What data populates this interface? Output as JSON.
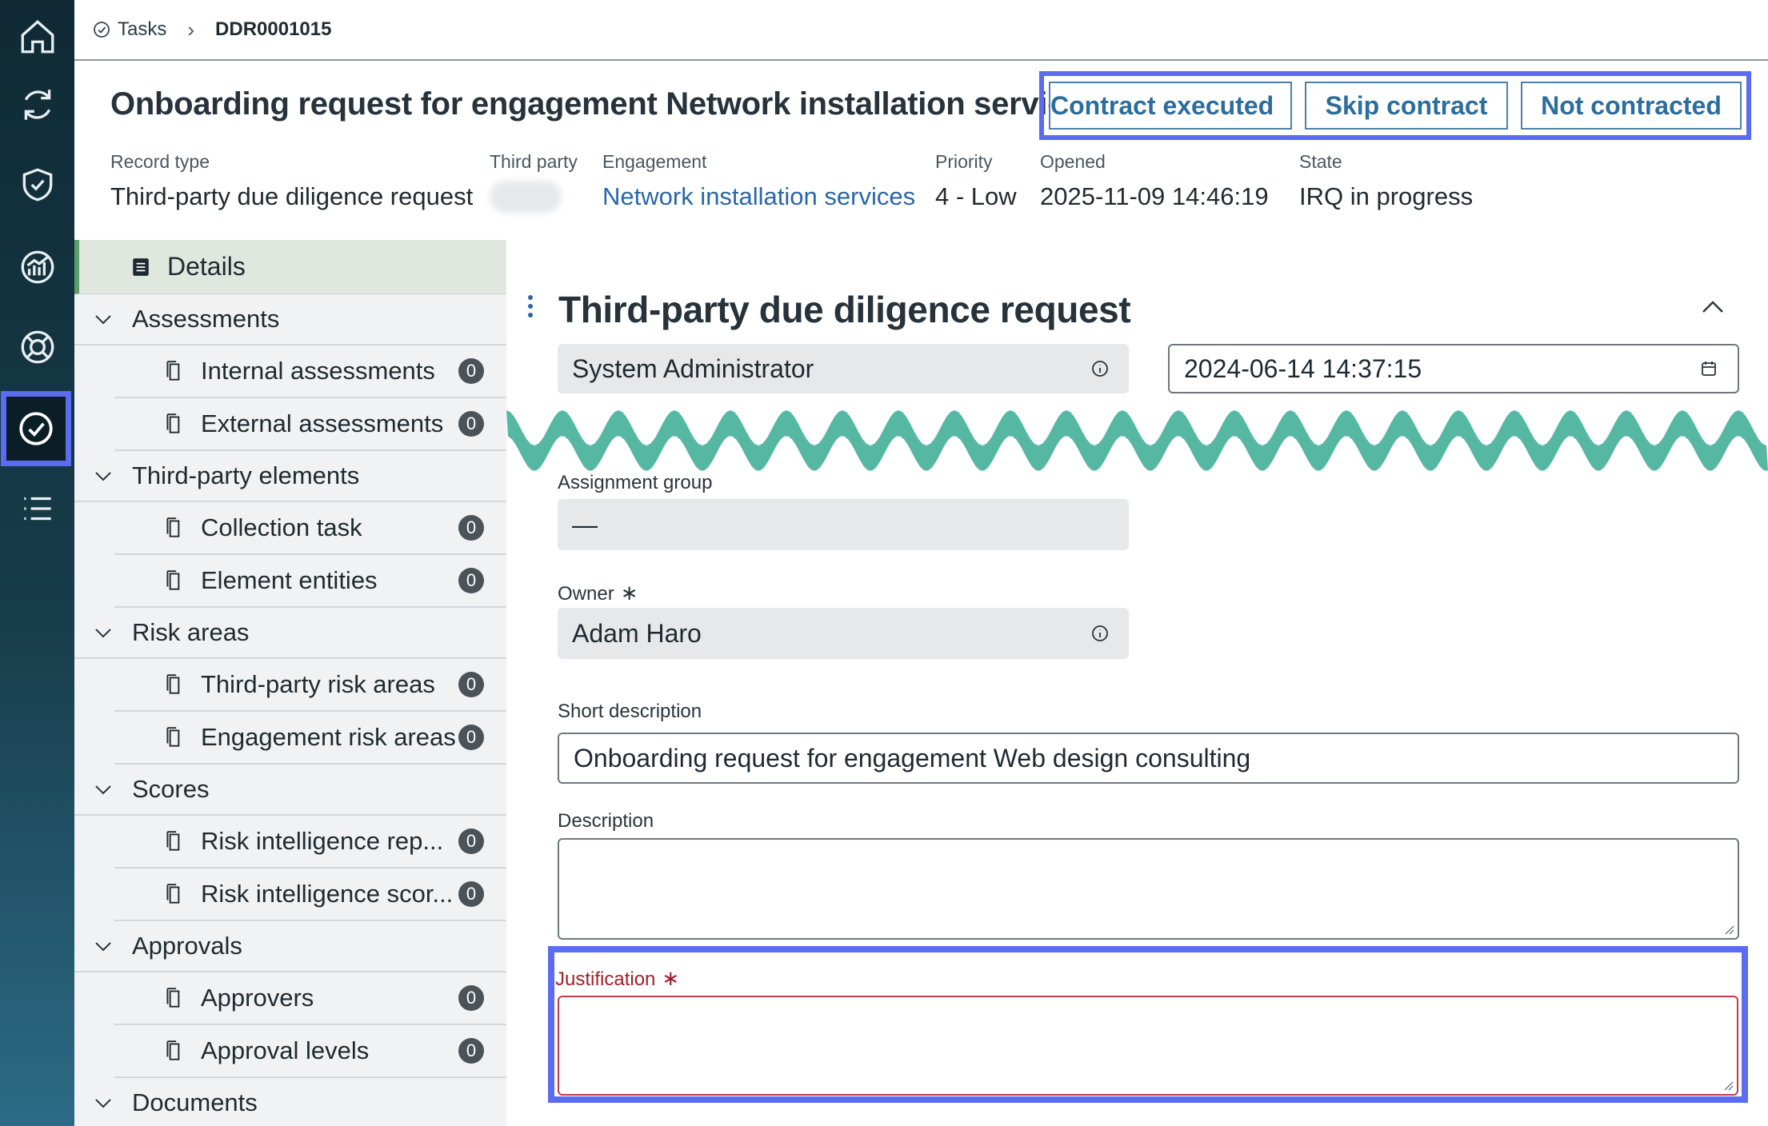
{
  "breadcrumb": {
    "tasks_label": "Tasks",
    "current": "DDR0001015"
  },
  "header": {
    "title": "Onboarding request for engagement Network installation services",
    "actions": [
      "Contract executed",
      "Skip contract",
      "Not contracted"
    ]
  },
  "meta": {
    "record_type_label": "Record type",
    "record_type": "Third-party due diligence request",
    "third_party_label": "Third party",
    "engagement_label": "Engagement",
    "engagement": "Network installation services",
    "priority_label": "Priority",
    "priority": "4 - Low",
    "opened_label": "Opened",
    "opened": "2025-11-09 14:46:19",
    "state_label": "State",
    "state": "IRQ in progress"
  },
  "tree": {
    "details": "Details",
    "groups": [
      {
        "label": "Assessments",
        "items": [
          {
            "label": "Internal assessments",
            "count": "0"
          },
          {
            "label": "External assessments",
            "count": "0"
          }
        ]
      },
      {
        "label": "Third-party elements",
        "items": [
          {
            "label": "Collection task",
            "count": "0"
          },
          {
            "label": "Element entities",
            "count": "0"
          }
        ]
      },
      {
        "label": "Risk areas",
        "items": [
          {
            "label": "Third-party risk areas",
            "count": "0"
          },
          {
            "label": "Engagement risk areas",
            "count": "0"
          }
        ]
      },
      {
        "label": "Scores",
        "items": [
          {
            "label": "Risk intelligence rep...",
            "count": "0"
          },
          {
            "label": "Risk intelligence scor...",
            "count": "0"
          }
        ]
      },
      {
        "label": "Approvals",
        "items": [
          {
            "label": "Approvers",
            "count": "0"
          },
          {
            "label": "Approval levels",
            "count": "0"
          }
        ]
      },
      {
        "label": "Documents",
        "items": []
      }
    ]
  },
  "form": {
    "title": "Third-party due diligence request",
    "requested_by": "System Administrator",
    "requested_date": "2024-06-14 14:37:15",
    "assignment_group_label": "Assignment group",
    "assignment_group": "—",
    "owner_label": "Owner",
    "owner": "Adam Haro",
    "short_description_label": "Short description",
    "short_description": "Onboarding request for engagement Web design consulting",
    "description_label": "Description",
    "justification_label": "Justification",
    "required_mark": "∗"
  },
  "colors": {
    "accent": "#5b6cf0",
    "link": "#2a67a8",
    "wave": "#56b8a3",
    "required": "#a01f2c"
  },
  "icons": [
    "home-icon",
    "refresh-icon",
    "shield-icon",
    "dashboard-icon",
    "support-icon",
    "check-circle-icon",
    "list-icon",
    "info-icon",
    "calendar-icon",
    "document-icon",
    "chevron-down-icon",
    "chevron-up-icon",
    "kebab-icon"
  ]
}
